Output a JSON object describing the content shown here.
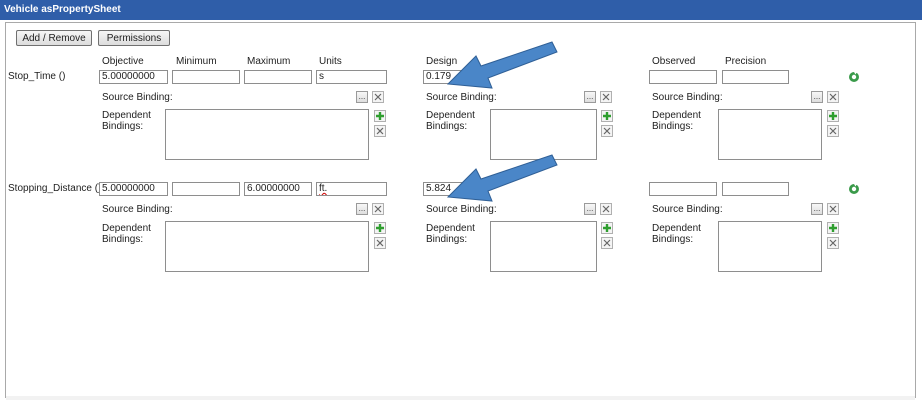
{
  "window": {
    "title": "Vehicle asPropertySheet"
  },
  "toolbar": {
    "add_remove_label": "Add / Remove",
    "permissions_label": "Permissions"
  },
  "columns": {
    "objective": "Objective",
    "minimum": "Minimum",
    "maximum": "Maximum",
    "units": "Units",
    "design": "Design",
    "observed": "Observed",
    "precision": "Precision"
  },
  "labels": {
    "source_binding": "Source Binding:",
    "dependent_bindings_line1": "Dependent",
    "dependent_bindings_line2": "Bindings:",
    "ellipsis": "..."
  },
  "properties": [
    {
      "name": "Stop_Time ()",
      "objective": "5.00000000",
      "minimum": "",
      "maximum": "",
      "units": "s",
      "design": "0.179",
      "observed": "",
      "precision": ""
    },
    {
      "name": "Stopping_Distance ()",
      "objective": "5.00000000",
      "minimum": "",
      "maximum": "6.00000000",
      "units": "ft.",
      "design": "5.824",
      "observed": "",
      "precision": ""
    }
  ],
  "colors": {
    "titlebar": "#2f5ea9",
    "arrow": "#4a86c8",
    "add_icon": "#2e9e2e"
  },
  "icons": [
    "refresh-icon",
    "add-icon",
    "remove-icon",
    "arrow-annotation"
  ]
}
